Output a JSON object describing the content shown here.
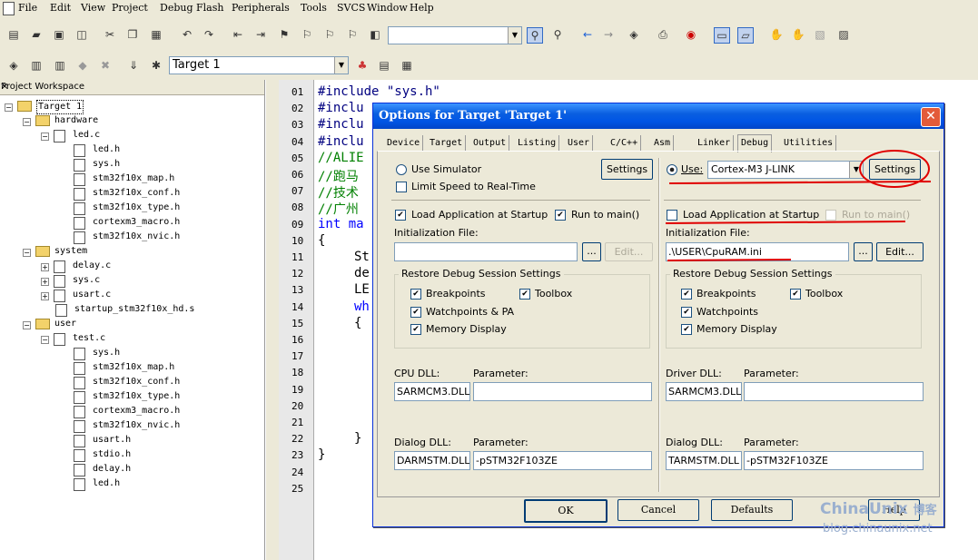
{
  "menu": [
    "File",
    "Edit",
    "View",
    "Project",
    "Debug",
    "Flash",
    "Peripherals",
    "Tools",
    "SVCS",
    "Window",
    "Help"
  ],
  "toolbar": {
    "target": "Target 1"
  },
  "workspace": {
    "title": "Project Workspace",
    "close": "×",
    "nodes": [
      "Target 1",
      "hardware",
      "led.c",
      "led.h",
      "sys.h",
      "stm32f10x_map.h",
      "stm32f10x_conf.h",
      "stm32f10x_type.h",
      "cortexm3_macro.h",
      "stm32f10x_nvic.h",
      "system",
      "delay.c",
      "sys.c",
      "usart.c",
      "startup_stm32f10x_hd.s",
      "user",
      "test.c",
      "sys.h",
      "stm32f10x_map.h",
      "stm32f10x_conf.h",
      "stm32f10x_type.h",
      "cortexm3_macro.h",
      "stm32f10x_nvic.h",
      "usart.h",
      "stdio.h",
      "delay.h",
      "led.h"
    ]
  },
  "editor": {
    "lines": [
      "01",
      "02",
      "03",
      "04",
      "05",
      "06",
      "07",
      "08",
      "09",
      "10",
      "11",
      "12",
      "13",
      "14",
      "15",
      "16",
      "17",
      "18",
      "19",
      "20",
      "21",
      "22",
      "23",
      "24",
      "25"
    ],
    "code": [
      "#include \"sys.h\"",
      "#inclu",
      "#inclu",
      "#inclu",
      "//ALIE",
      "//跑马",
      "//技术",
      "//广州",
      "int ma",
      "{",
      "St",
      "de",
      "LE",
      "wh",
      "{",
      "",
      "",
      "",
      "",
      "",
      "",
      "}",
      "}",
      "",
      ""
    ]
  },
  "dialog": {
    "title": "Options for Target 'Target 1'",
    "close": "✕",
    "tabs": [
      "Device",
      "Target",
      "Output",
      "Listing",
      "User",
      "C/C++",
      "Asm",
      "Linker",
      "Debug",
      "Utilities"
    ],
    "left": {
      "use_simulator": "Use Simulator",
      "settings": "Settings",
      "limit_speed": "Limit Speed to Real-Time",
      "load_app": "Load Application at Startup",
      "run_to_main": "Run to main()",
      "init_file_label": "Initialization File:",
      "init_file": "",
      "browse": "...",
      "edit": "Edit...",
      "restore": "Restore Debug Session Settings",
      "breakpoints": "Breakpoints",
      "toolbox": "Toolbox",
      "watchpoints": "Watchpoints & PA",
      "memory": "Memory Display",
      "cpu_dll_label": "CPU DLL:",
      "param_label": "Parameter:",
      "cpu_dll": "SARMCM3.DLL",
      "cpu_param": "",
      "dialog_dll_label": "Dialog DLL:",
      "dialog_param_label": "Parameter:",
      "dialog_dll": "DARMSTM.DLL",
      "dialog_param": "-pSTM32F103ZE"
    },
    "right": {
      "use": "Use:",
      "driver": "Cortex-M3 J-LINK",
      "settings": "Settings",
      "load_app": "Load Application at Startup",
      "run_to_main": "Run to main()",
      "init_file_label": "Initialization File:",
      "init_file": ".\\USER\\CpuRAM.ini",
      "browse": "...",
      "edit": "Edit...",
      "restore": "Restore Debug Session Settings",
      "breakpoints": "Breakpoints",
      "toolbox": "Toolbox",
      "watchpoints": "Watchpoints",
      "memory": "Memory Display",
      "driver_dll_label": "Driver DLL:",
      "param_label": "Parameter:",
      "driver_dll": "SARMCM3.DLL",
      "driver_param": "",
      "dialog_dll_label": "Dialog DLL:",
      "dialog_param_label": "Parameter:",
      "dialog_dll": "TARMSTM.DLL",
      "dialog_param": "-pSTM32F103ZE"
    },
    "buttons": {
      "ok": "OK",
      "cancel": "Cancel",
      "defaults": "Defaults",
      "help": "Help"
    }
  },
  "watermark": {
    "brand": "ChinaUnix",
    "suffix": "博客",
    "url": "blog.chinaunix.net"
  },
  "colors": {
    "annotation": "#e00000",
    "titlebar": "#0055e5",
    "comment": "#008000",
    "keyword": "#0000ff"
  }
}
